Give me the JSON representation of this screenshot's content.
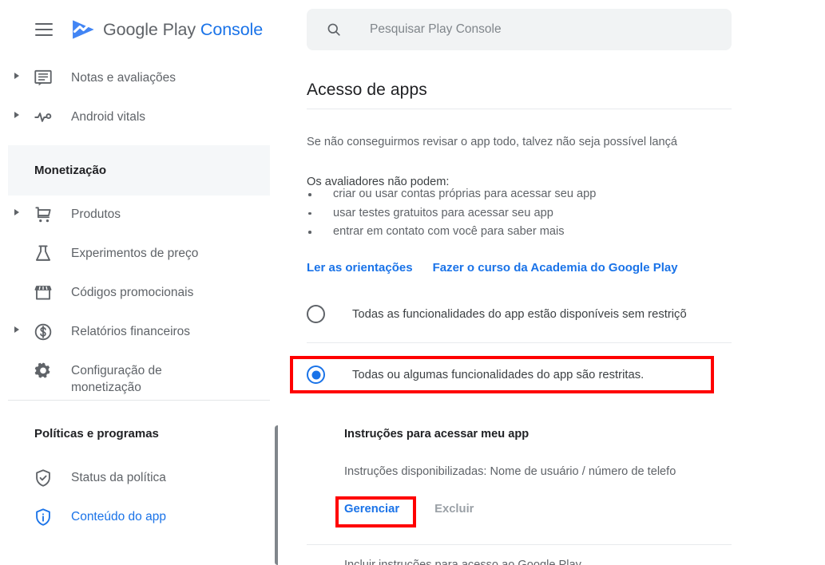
{
  "brand": {
    "menu_icon": "hamburger-menu-icon",
    "logo_icon": "google-play-console-logo",
    "name_primary": "Google Play",
    "name_secondary": "Console"
  },
  "search": {
    "icon": "search-icon",
    "placeholder": "Pesquisar Play Console",
    "value": ""
  },
  "sidebar": {
    "items": [
      {
        "label": "Notas e avaliações",
        "icon": "reviews-comment-icon",
        "expandable": true,
        "active": false
      },
      {
        "label": "Android vitals",
        "icon": "android-vitals-pulse-icon",
        "expandable": true,
        "active": false
      }
    ],
    "sections": [
      {
        "title": "Monetização",
        "shaded": true,
        "items": [
          {
            "label": "Produtos",
            "icon": "shopping-cart-icon",
            "expandable": true,
            "active": false
          },
          {
            "label": "Experimentos de preço",
            "icon": "flask-beaker-icon",
            "expandable": false,
            "active": false
          },
          {
            "label": "Códigos promocionais",
            "icon": "storefront-icon",
            "expandable": false,
            "active": false
          },
          {
            "label": "Relatórios financeiros",
            "icon": "dollar-circle-icon",
            "expandable": true,
            "active": false
          },
          {
            "label": "Configuração de monetização",
            "icon": "gear-icon",
            "expandable": false,
            "active": false
          }
        ]
      },
      {
        "title": "Políticas e programas",
        "shaded": false,
        "items": [
          {
            "label": "Status da política",
            "icon": "shield-check-icon",
            "expandable": false,
            "active": false
          },
          {
            "label": "Conteúdo do app",
            "icon": "shield-info-icon",
            "expandable": false,
            "active": true
          }
        ]
      }
    ]
  },
  "main": {
    "page_title": "Acesso de apps",
    "intro_text": "Se não conseguirmos revisar o app todo, talvez não seja possível lançá",
    "cannot_heading": "Os avaliadores não podem:",
    "cannot_items": [
      "criar ou usar contas próprias para acessar seu app",
      "usar testes gratuitos para acessar seu app",
      "entrar em contato com você para saber mais"
    ],
    "links": [
      "Ler as orientações",
      "Fazer o curso da Academia do Google Play"
    ],
    "radio_options": [
      {
        "label": "Todas as funcionalidades do app estão disponíveis sem restriçõ",
        "selected": false,
        "highlighted": false
      },
      {
        "label": "Todas ou algumas funcionalidades do app são restritas.",
        "selected": true,
        "highlighted": true
      }
    ],
    "instructions": {
      "title": "Instruções para acessar meu app",
      "description": "Instruções disponibilizadas: Nome de usuário / número de telefo",
      "manage_label": "Gerenciar",
      "delete_label": "Excluir",
      "manage_highlighted": true,
      "delete_disabled": true
    },
    "cutoff_text": "Incluir instruções para acesso ao Google Play"
  },
  "annotations": {
    "highlight_color": "#ff0000",
    "boxes": [
      {
        "target": "radio-option-restricted"
      },
      {
        "target": "manage-instructions-button"
      }
    ]
  },
  "colors": {
    "accent_blue": "#1a73e8",
    "text_primary": "#202124",
    "text_secondary": "#5f6368",
    "surface_gray": "#f1f3f4",
    "section_shade": "#f5f7f9",
    "scrollbar": "#80868b"
  },
  "scrollbar": {
    "name": "vertical-scrollbar"
  }
}
